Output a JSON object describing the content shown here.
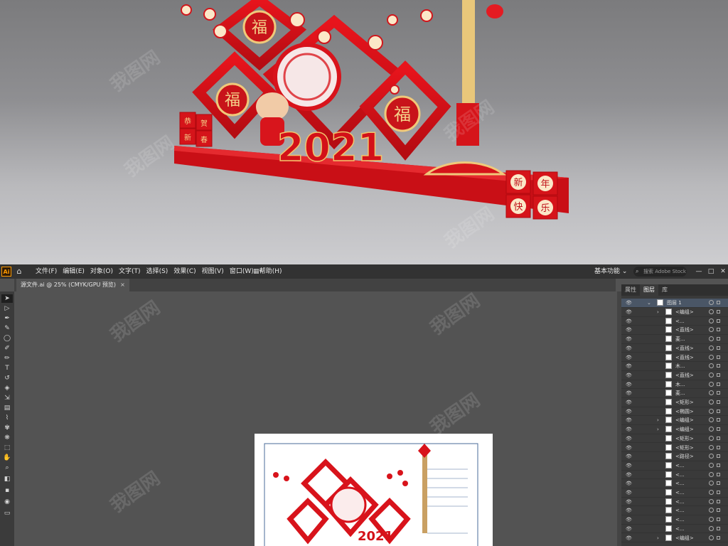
{
  "render_scene": {
    "banner_year": "2021",
    "fu_char": "福",
    "cubes_left": [
      "恭",
      "贺",
      "新",
      "春"
    ],
    "cubes_right": [
      "新",
      "年",
      "快",
      "乐"
    ]
  },
  "app": {
    "logo": "Ai",
    "menus": [
      "文件(F)",
      "编辑(E)",
      "对象(O)",
      "文字(T)",
      "选择(S)",
      "效果(C)",
      "视图(V)",
      "窗口(W)",
      "帮助(H)"
    ],
    "workspace": "基本功能",
    "search_placeholder": "搜索 Adobe Stock",
    "window_buttons": [
      "—",
      "□",
      "✕"
    ]
  },
  "document": {
    "tab_title": "源文件.ai @ 25% (CMYK/GPU 预览)",
    "close": "×"
  },
  "panel": {
    "tabs": [
      "属性",
      "图层",
      "库"
    ],
    "layer_title": "图层 1",
    "layers": [
      "<编组>",
      "<...",
      "<直线>",
      "麦...",
      "<直线>",
      "<直线>",
      "木...",
      "<直线>",
      "木...",
      "麦...",
      "<矩形>",
      "<椭圆>",
      "<编组>",
      "<编组>",
      "<矩形>",
      "<矩形>",
      "<路径>",
      "<...",
      "<...",
      "<...",
      "<...",
      "<...",
      "<...",
      "<...",
      "<...",
      "<编组>"
    ]
  },
  "watermark": "我图网"
}
